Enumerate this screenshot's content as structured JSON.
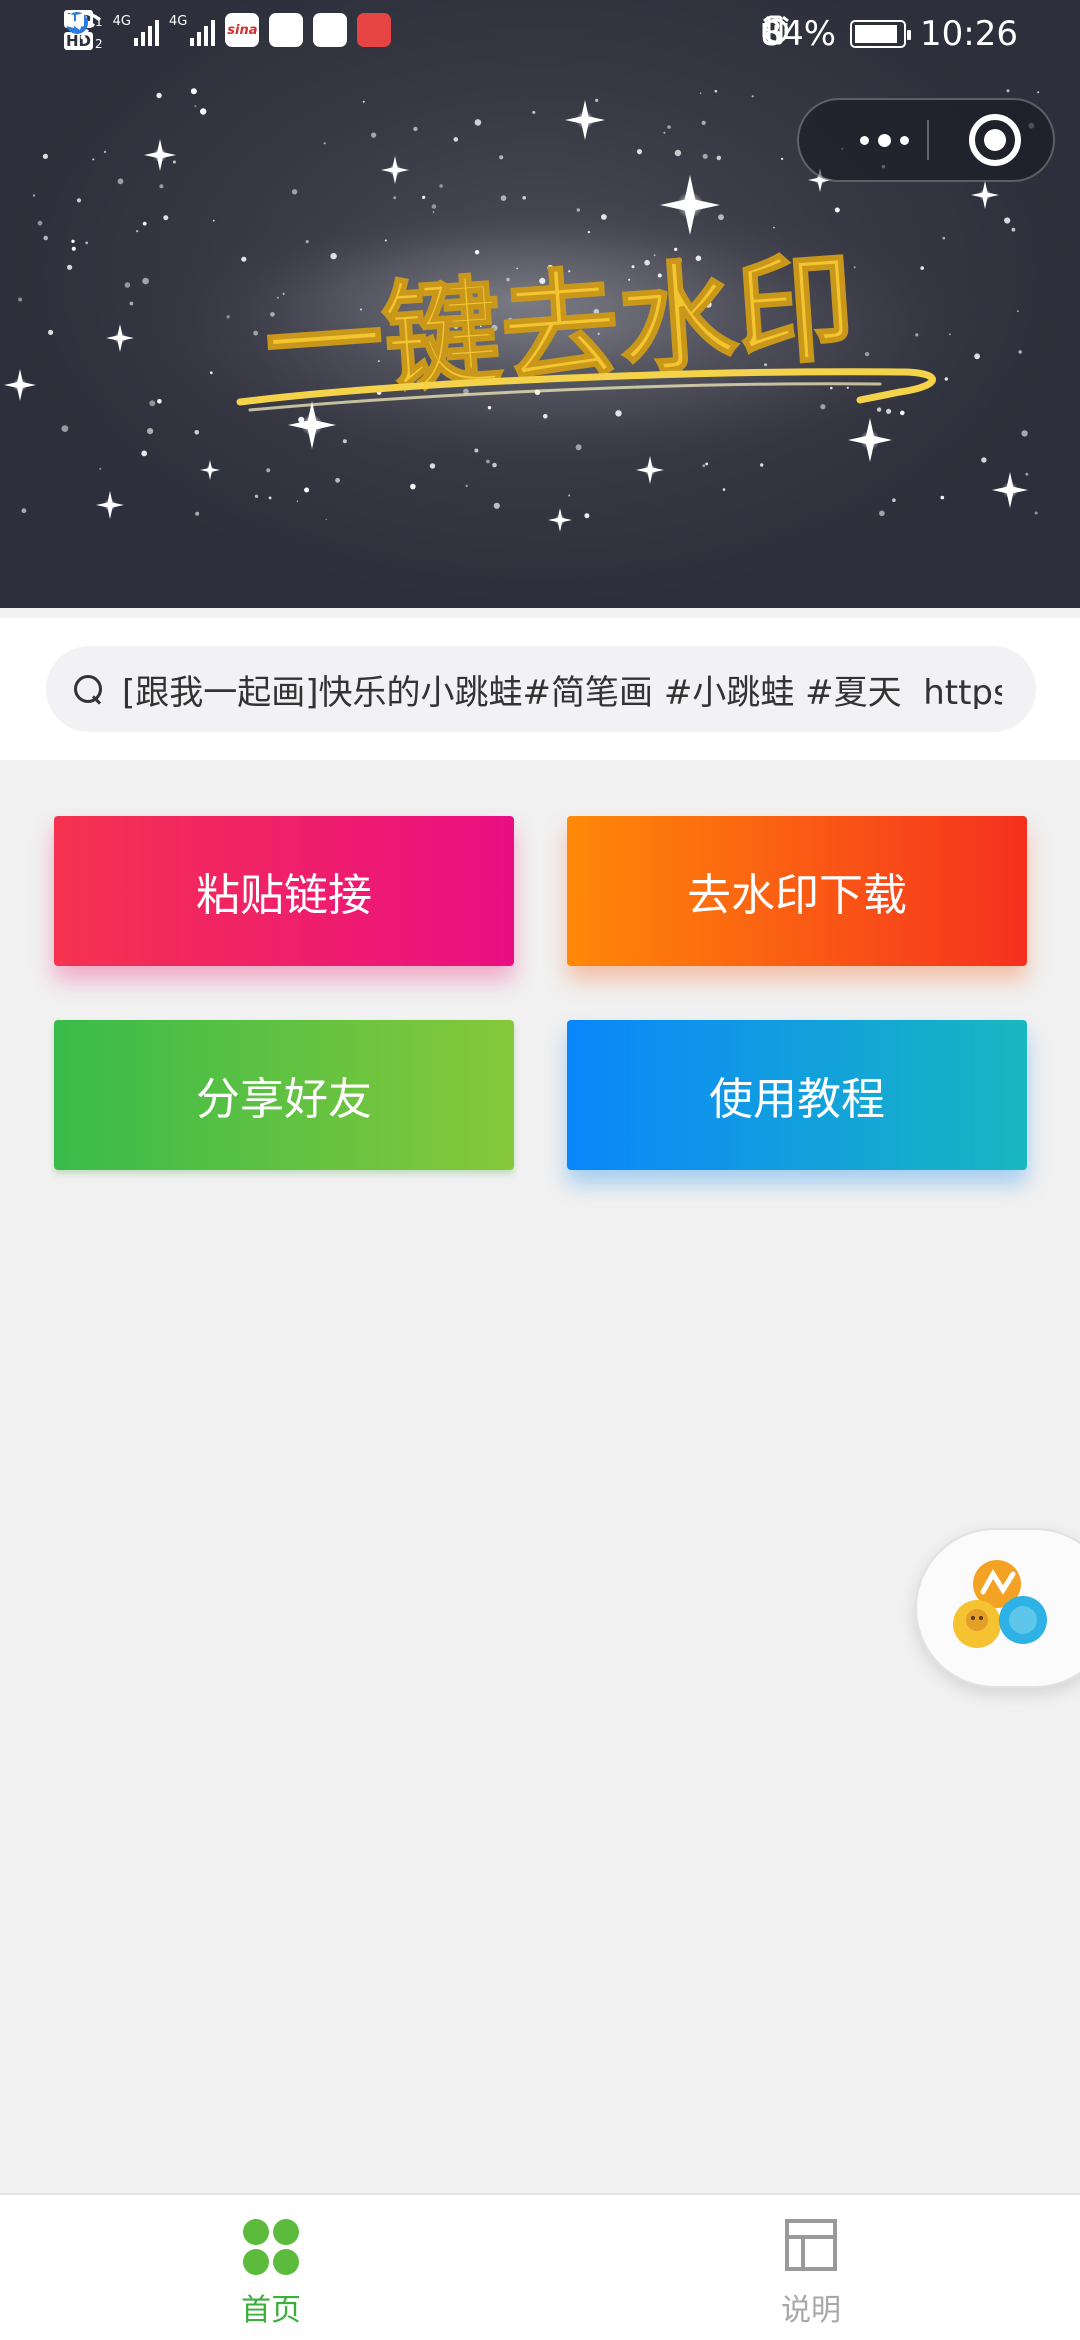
{
  "status_bar": {
    "network_left": "4G",
    "network_right": "4G",
    "hd_badge": "HD",
    "sim1": "1",
    "sim2": "2",
    "app_icon_sina": "sina",
    "battery_text": "84%",
    "time": "10:26"
  },
  "banner": {
    "title": "一键去水印"
  },
  "search": {
    "value": "[跟我一起画]快乐的小跳蛙#简笔画 #小跳蛙 #夏天  https://v.douyin.com/",
    "placeholder": ""
  },
  "buttons": {
    "paste": "粘贴链接",
    "download": "去水印下载",
    "share": "分享好友",
    "tutorial": "使用教程"
  },
  "tabbar": {
    "home": "首页",
    "help": "说明"
  },
  "colors": {
    "active_tab": "#3cae3b",
    "inactive_tab": "#a8a8a8",
    "title_yellow": "#f4c531"
  }
}
